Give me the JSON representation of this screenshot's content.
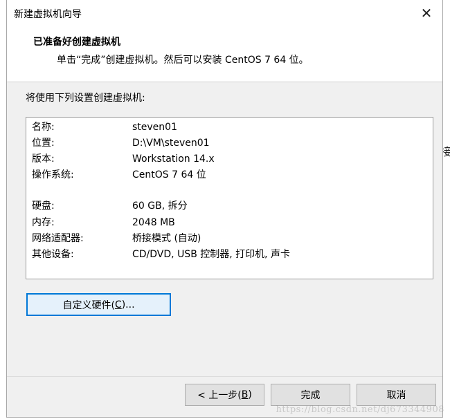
{
  "window": {
    "title": "新建虚拟机向导",
    "close_glyph": "✕"
  },
  "header": {
    "title": "已准备好创建虚拟机",
    "subtitle": "单击“完成”创建虚拟机。然后可以安装 CentOS 7 64 位。"
  },
  "intro": "将使用下列设置创建虚拟机:",
  "summary": {
    "rows": [
      {
        "key": "名称:",
        "value": "steven01"
      },
      {
        "key": "位置:",
        "value": "D:\\VM\\steven01"
      },
      {
        "key": "版本:",
        "value": "Workstation 14.x"
      },
      {
        "key": "操作系统:",
        "value": "CentOS 7 64 位"
      },
      {
        "key": "硬盘:",
        "value": "60 GB, 拆分"
      },
      {
        "key": "内存:",
        "value": "2048 MB"
      },
      {
        "key": "网络适配器:",
        "value": "桥接模式 (自动)"
      },
      {
        "key": "其他设备:",
        "value": "CD/DVD, USB 控制器, 打印机, 声卡"
      }
    ]
  },
  "customize_button": {
    "pre": "自定义硬件(",
    "key": "C",
    "post": ")..."
  },
  "footer": {
    "back": {
      "pre": "< 上一步(",
      "key": "B",
      "post": ")"
    },
    "finish": "完成",
    "cancel": "取消"
  },
  "background": {
    "partial_text": "接"
  },
  "watermark": "https://blog.csdn.net/dj673344908"
}
